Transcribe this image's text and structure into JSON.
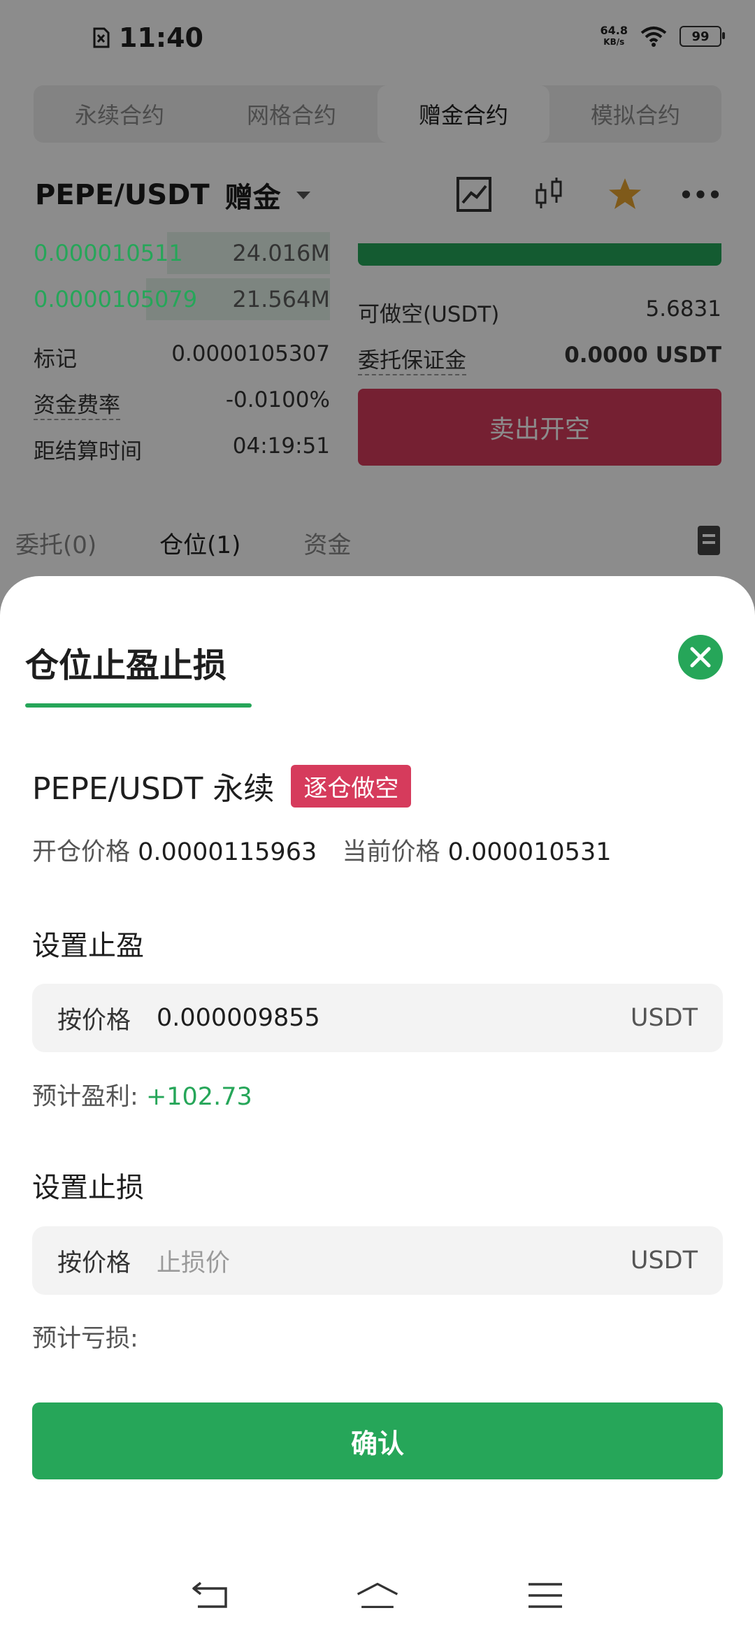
{
  "status": {
    "time": "11:40",
    "net_speed_value": "64.8",
    "net_speed_unit": "KB/s",
    "battery": "99"
  },
  "tabs": [
    {
      "label": "永续合约"
    },
    {
      "label": "网格合约"
    },
    {
      "label": "赠金合约",
      "active": true
    },
    {
      "label": "模拟合约"
    }
  ],
  "pair": {
    "symbol": "PEPE/USDT",
    "mode": "赠金"
  },
  "orderbook": [
    {
      "price": "0.000010511",
      "qty": "24.016M",
      "depth": 0.55
    },
    {
      "price": "0.0000105079",
      "qty": "21.564M",
      "depth": 0.62
    }
  ],
  "info": {
    "mark_label": "标记",
    "mark_value": "0.0000105307",
    "funding_label": "资金费率",
    "funding_value": "-0.0100%",
    "settle_label": "距结算时间",
    "settle_value": "04:19:51"
  },
  "right_panel": {
    "short_label": "可做空(USDT)",
    "short_value": "5.6831",
    "margin_label": "委托保证金",
    "margin_value": "0.0000 USDT",
    "sell_button": "卖出开空"
  },
  "sub_tabs": [
    "委托(0)",
    "仓位(1)",
    "资金"
  ],
  "sheet": {
    "title": "仓位止盈止损",
    "symbol": "PEPE/USDT 永续",
    "badge": "逐仓做空",
    "open_price_label": "开仓价格",
    "open_price": "0.0000115963",
    "current_price_label": "当前价格",
    "current_price": "0.000010531",
    "take_profit": {
      "title": "设置止盈",
      "mode": "按价格",
      "value": "0.000009855",
      "unit": "USDT",
      "est_label": "预计盈利:",
      "est_value": "+102.73"
    },
    "stop_loss": {
      "title": "设置止损",
      "mode": "按价格",
      "placeholder": "止损价",
      "unit": "USDT",
      "est_label": "预计亏损:",
      "est_value": ""
    },
    "confirm": "确认"
  },
  "colors": {
    "accent": "#26a659",
    "sell": "#d63b5c"
  }
}
